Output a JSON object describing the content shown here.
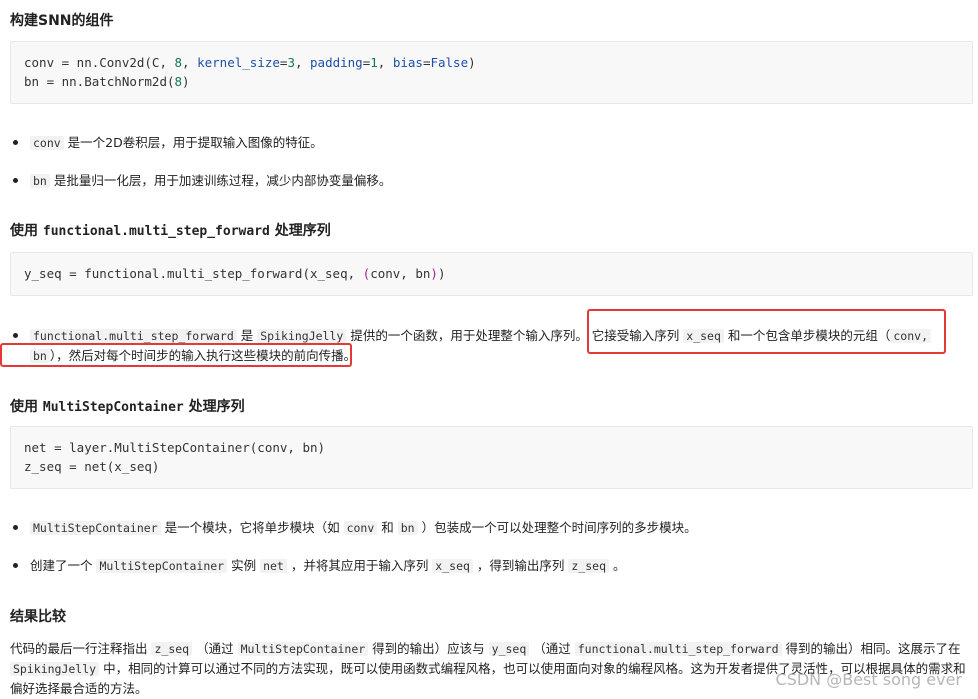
{
  "section1": {
    "heading": "构建SNN的组件",
    "code_line1": {
      "a": "conv = nn.Conv2d(C, ",
      "n1": "8",
      "b": ", ",
      "kw1": "kernel_size",
      "c": "=",
      "n2": "3",
      "d": ", ",
      "kw2": "padding",
      "e": "=",
      "n3": "1",
      "f": ", ",
      "kw3": "bias",
      "g": "=",
      "kw4": "False",
      "h": ")"
    },
    "code_line2": {
      "a": "bn = nn.BatchNorm2d(",
      "n1": "8",
      "b": ")"
    },
    "bullets": [
      {
        "code": "conv",
        "text": " 是一个2D卷积层，用于提取输入图像的特征。"
      },
      {
        "code": "bn",
        "text": " 是批量归一化层，用于加速训练过程，减少内部协变量偏移。"
      }
    ]
  },
  "section2": {
    "heading_prefix": "使用 ",
    "heading_code": "functional.multi_step_forward",
    "heading_suffix": " 处理序列",
    "code_line1": {
      "a": "y_seq = functional.multi_step_forward(x_seq, ",
      "p1": "(",
      "b": "conv, bn",
      "p2": ")",
      "c": ")"
    },
    "bullet": {
      "code1": "functional.multi_step_forward",
      "t1": " 是 ",
      "code2": "SpikingJelly",
      "t2": " 提供的一个函数，用于处理整个输入序列。 它接受输入序列 ",
      "code3": "x_seq",
      "t3": " 和一个包含单步模块的元组（",
      "code4": "conv,",
      "t4": " ",
      "code5": "bn",
      "t5": "），然后对每个时间步的输入执行这些模块的前向传播。"
    }
  },
  "section3": {
    "heading_prefix": "使用 ",
    "heading_code": "MultiStepContainer",
    "heading_suffix": " 处理序列",
    "code_line1": "net = layer.MultiStepContainer(conv, bn)",
    "code_line2": "z_seq = net(x_seq)",
    "bullet1": {
      "code1": "MultiStepContainer",
      "t1": " 是一个模块，它将单步模块（如 ",
      "code2": "conv",
      "t2": " 和 ",
      "code3": "bn",
      "t3": " ）包装成一个可以处理整个时间序列的多步模块。"
    },
    "bullet2": {
      "t0": "创建了一个 ",
      "code1": "MultiStepContainer",
      "t1": " 实例 ",
      "code2": "net",
      "t2": " ，并将其应用于输入序列 ",
      "code3": "x_seq",
      "t3": " ，得到输出序列 ",
      "code4": "z_seq",
      "t4": " 。"
    }
  },
  "section4": {
    "heading": "结果比较",
    "p": {
      "t0": "代码的最后一行注释指出 ",
      "c1": "z_seq",
      "t1": " （通过 ",
      "c2": "MultiStepContainer",
      "t2": " 得到的输出）应该与 ",
      "c3": "y_seq",
      "t3": " （通过 ",
      "c4": "functional.multi_step_forward",
      "t4": " 得到的输出）相同。这展示了在 ",
      "c5": "SpikingJelly",
      "t5": " 中，相同的计算可以通过不同的方法实现，既可以使用函数式编程风格，也可以使用面向对象的编程风格。这为开发者提供了灵活性，可以根据具体的需求和偏好选择最合适的方法。"
    }
  },
  "watermark": "CSDN @Best song ever",
  "colors": {
    "highlight_border": "#e53935"
  }
}
